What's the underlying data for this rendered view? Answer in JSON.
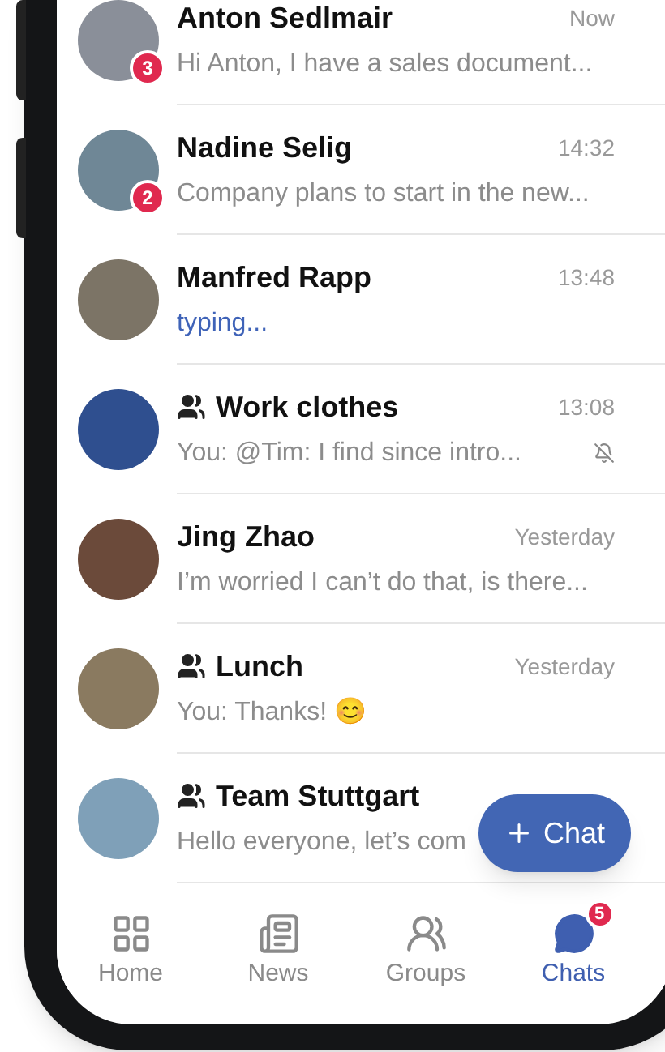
{
  "chats": [
    {
      "kind": "person",
      "name": "Anton Sedlmair",
      "time": "Now",
      "preview": "Hi Anton, I have a sales document...",
      "unread": "3",
      "typing": false,
      "muted": false
    },
    {
      "kind": "person",
      "name": "Nadine Selig",
      "time": "14:32",
      "preview": "Company plans to start in the new...",
      "unread": "2",
      "typing": false,
      "muted": false
    },
    {
      "kind": "person",
      "name": "Manfred Rapp",
      "time": "13:48",
      "preview": "typing...",
      "typing": true,
      "muted": false
    },
    {
      "kind": "group",
      "name": "Work clothes",
      "time": "13:08",
      "preview": "You: @Tim: I find since intro...",
      "typing": false,
      "muted": true
    },
    {
      "kind": "person",
      "name": "Jing Zhao",
      "time": "Yesterday",
      "preview": "I’m worried I can’t do that, is there...",
      "typing": false,
      "muted": false
    },
    {
      "kind": "group",
      "name": "Lunch",
      "time": "Yesterday",
      "preview": "You: Thanks! 😊",
      "typing": false,
      "muted": false
    },
    {
      "kind": "group",
      "name": "Team Stuttgart",
      "preview": "Hello everyone, let’s com",
      "typing": false,
      "muted": false
    }
  ],
  "fab": {
    "label": "Chat"
  },
  "nav": [
    {
      "kind": "home",
      "label": "Home",
      "selected": false
    },
    {
      "kind": "news",
      "label": "News",
      "selected": false
    },
    {
      "kind": "groups",
      "label": "Groups",
      "selected": false
    },
    {
      "kind": "chats",
      "label": "Chats",
      "selected": true,
      "badge": "5"
    }
  ]
}
